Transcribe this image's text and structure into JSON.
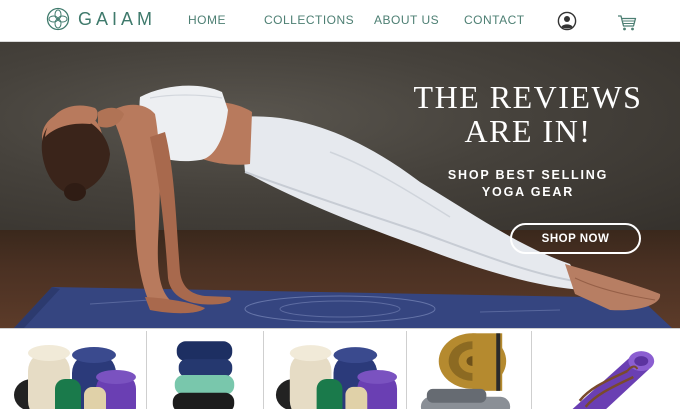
{
  "brand": {
    "name": "GAIAM",
    "color": "#3f7a6c"
  },
  "nav": {
    "items": [
      "HOME",
      "COLLECTIONS",
      "ABOUT US",
      "CONTACT"
    ],
    "icons": [
      "user-icon",
      "cart-icon"
    ]
  },
  "hero": {
    "headline_line1": "THE REVIEWS",
    "headline_line2": "ARE IN!",
    "subhead_line1": "SHOP BEST SELLING",
    "subhead_line2": "YOGA GEAR",
    "cta_label": "SHOP NOW"
  },
  "products": [
    {
      "icon": "yoga-straps-bundle-image"
    },
    {
      "icon": "folded-yoga-towels-image"
    },
    {
      "icon": "yoga-straps-bundle-image"
    },
    {
      "icon": "rolled-yoga-mats-image"
    },
    {
      "icon": "purple-yoga-mat-with-strap-image"
    }
  ],
  "colors": {
    "accent": "#3f7a6c",
    "mat_blue": "#3d4d8a",
    "purple": "#6a3fb3"
  }
}
